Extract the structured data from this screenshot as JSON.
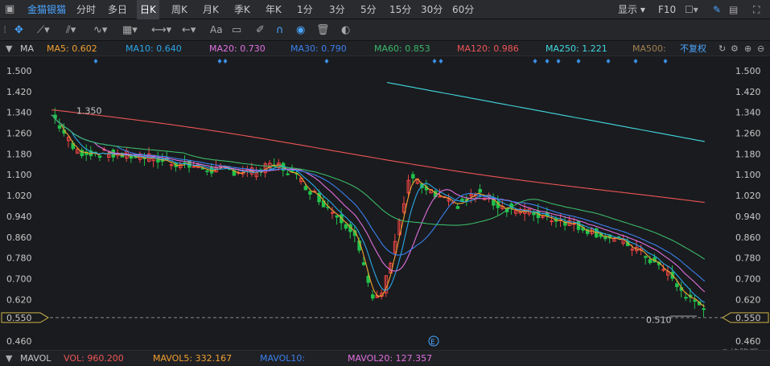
{
  "topbar": {
    "stock_name": "金猫银猫",
    "periods": [
      "分时",
      "多日",
      "日K",
      "周K",
      "月K",
      "季K",
      "年K",
      "1分",
      "3分",
      "5分",
      "15分",
      "30分",
      "60分"
    ],
    "active_period": "日K",
    "display_label": "显示",
    "f10_label": "F10"
  },
  "toolbar": {
    "icons": [
      "crosshair-icon",
      "line-icon",
      "channel-icon",
      "wave-icon",
      "measure-icon",
      "arrow-left-icon",
      "text-icon",
      "comment-icon",
      "eraser-icon",
      "magnet-icon",
      "eye-icon",
      "trash-icon",
      "toggle-icon"
    ],
    "text_tool_label": "Aa"
  },
  "ma_bar": {
    "label": "MA",
    "items": [
      {
        "text": "MA5: 0.602",
        "color": "#f0a030"
      },
      {
        "text": "MA10: 0.640",
        "color": "#2aa7e8"
      },
      {
        "text": "MA20: 0.730",
        "color": "#e070e0"
      },
      {
        "text": "MA30: 0.790",
        "color": "#3a80ee"
      },
      {
        "text": "MA60: 0.853",
        "color": "#3ab86a"
      },
      {
        "text": "MA120: 0.986",
        "color": "#ee5555"
      },
      {
        "text": "MA250: 1.221",
        "color": "#40d8e0"
      },
      {
        "text": "MA500:",
        "color": "#a08050"
      }
    ],
    "adjust_label": "不复权"
  },
  "vol_bar": {
    "label": "MAVOL",
    "items": [
      {
        "text": "VOL: 960.200",
        "color": "#ee5555"
      },
      {
        "text": "MAVOL5: 332.167",
        "color": "#f0a030"
      },
      {
        "text": "MAVOL10:",
        "color": "#3a80ee"
      },
      {
        "text": "MAVOL20: 127.357",
        "color": "#e070e0"
      }
    ]
  },
  "chart_data": {
    "type": "line",
    "y_ticks": [
      "1.500",
      "1.420",
      "1.340",
      "1.260",
      "1.180",
      "1.100",
      "1.020",
      "0.940",
      "0.860",
      "0.780",
      "0.700",
      "0.620",
      "0.550",
      "0.460"
    ],
    "ylim": [
      0.46,
      1.52
    ],
    "current_price": "0.550",
    "annotations": [
      {
        "text": "1.350"
      },
      {
        "text": "0.510"
      }
    ],
    "event_marker": "E",
    "colors": {
      "up": "#ee4444",
      "down": "#22c24c",
      "ma5": "#f0a030",
      "ma10": "#2aa7e8",
      "ma20": "#e070e0",
      "ma30": "#3a80ee",
      "ma60": "#3ab86a",
      "ma120": "#ee5555",
      "ma250": "#40d8e0",
      "diamond": "#3a90e8"
    }
  },
  "watermark": "©格隆汇"
}
